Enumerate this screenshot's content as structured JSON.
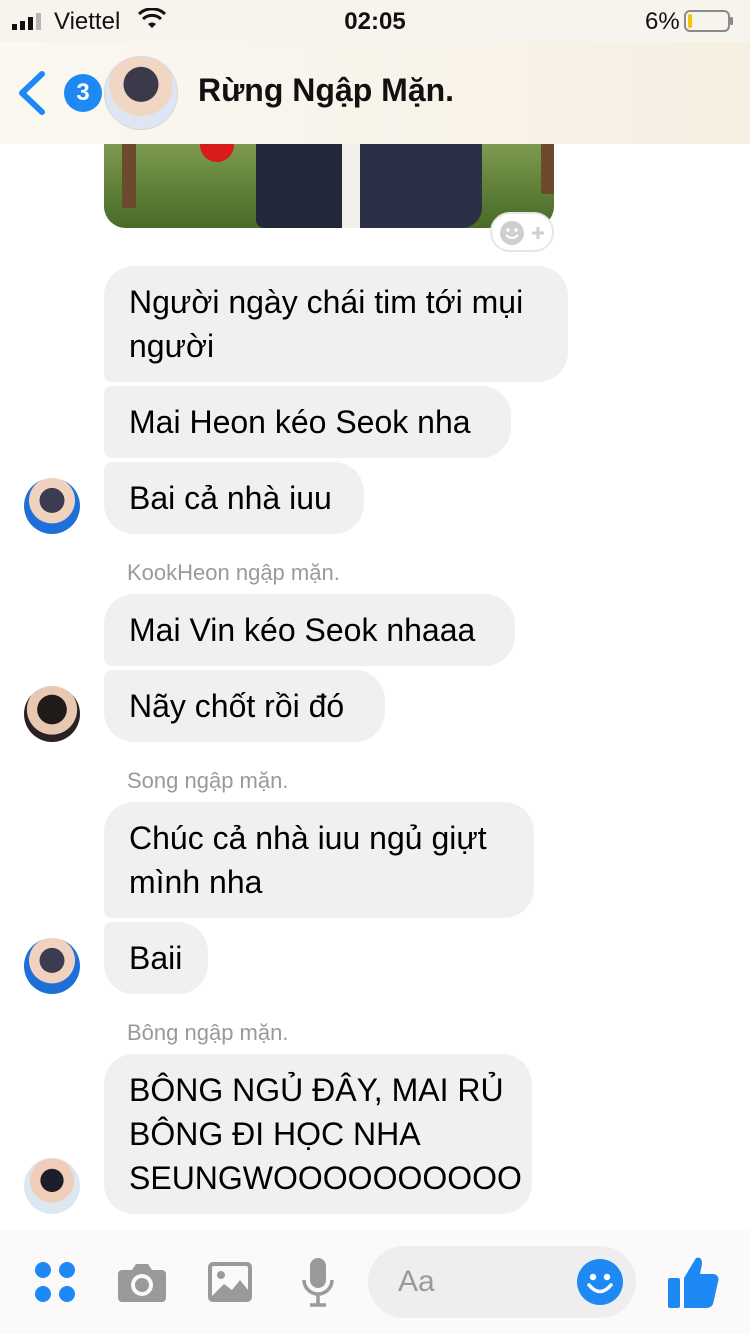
{
  "status_bar": {
    "carrier": "Viettel",
    "time": "02:05",
    "battery_percent": "6%",
    "battery_level": 0.06,
    "icons": [
      "signal-icon",
      "wifi-icon",
      "battery-icon"
    ]
  },
  "header": {
    "back_badge": "3",
    "title": "Rừng Ngập Mặn."
  },
  "messages": [
    {
      "text": "Người ngày chái tim tới mụi",
      "text2": "người"
    },
    {
      "text": "Mai Heon kéo Seok nha"
    },
    {
      "text": "Bai cả nhà iuu"
    },
    {
      "sender": "KookHeon ngập mặn."
    },
    {
      "text": "Mai Vin kéo Seok nhaaa"
    },
    {
      "text": "Nãy chốt rồi đó"
    },
    {
      "sender": "Song ngập mặn."
    },
    {
      "text": "Chúc cả nhà iuu ngủ giựt",
      "text2": "mình nha"
    },
    {
      "text": "Baii"
    },
    {
      "sender": "Bông ngập mặn."
    },
    {
      "text": "BÔNG NGỦ ĐÂY, MAI RỦ",
      "text2": "BÔNG ĐI HỌC NHA",
      "text3": "SEUNGWOOOOOOOOOO"
    }
  ],
  "composer": {
    "placeholder": "Aa",
    "icons": [
      "apps-icon",
      "camera-icon",
      "image-icon",
      "microphone-icon",
      "emoji-icon",
      "thumbs-up-icon"
    ]
  },
  "colors": {
    "accent": "#1e88f5",
    "bubble": "#f0f0f0",
    "sender_label": "#9a9a9a"
  }
}
